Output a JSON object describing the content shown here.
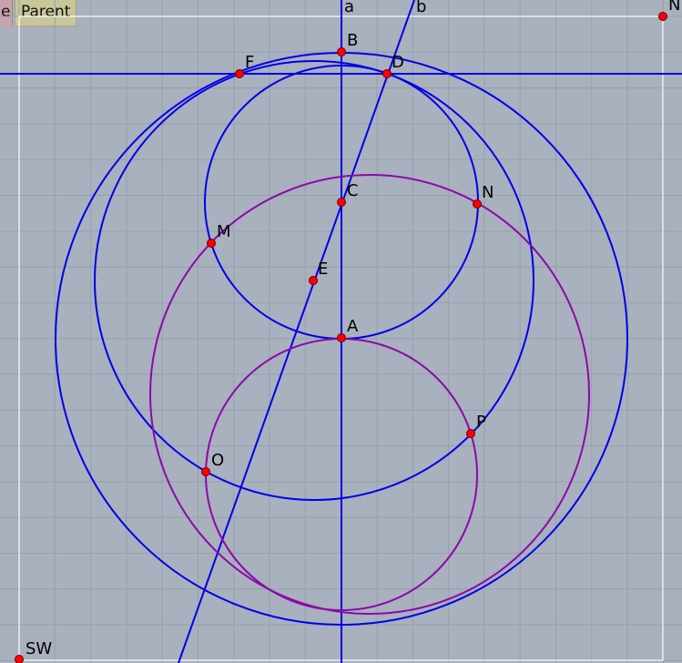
{
  "toolbar": {
    "partial_tab": "e",
    "parent_tab": "Parent"
  },
  "colors": {
    "background": "#a9b0be",
    "grid_line": "#98a0ae",
    "frame": "#ffffff",
    "blue": "#0000e6",
    "purple": "#8a0aa8",
    "point": "#ff0000"
  },
  "labels": {
    "line_a": "a",
    "line_b": "b",
    "B": "B",
    "F": "F",
    "D": "D",
    "C": "C",
    "N": "N",
    "M": "M",
    "E": "E",
    "A": "A",
    "P": "P",
    "O": "O",
    "NE": "NE",
    "SW": "SW"
  }
}
